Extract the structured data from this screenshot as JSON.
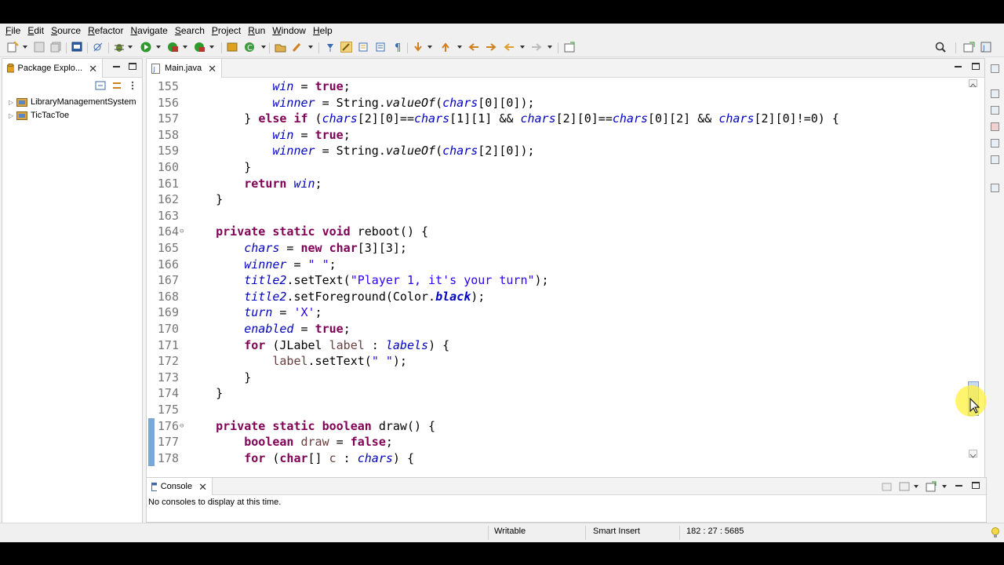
{
  "menu": [
    "File",
    "Edit",
    "Source",
    "Refactor",
    "Navigate",
    "Search",
    "Project",
    "Run",
    "Window",
    "Help"
  ],
  "left_view": {
    "tab_label": "Package Explo...",
    "projects": [
      "LibraryManagementSystem",
      "TicTacToe"
    ]
  },
  "editor": {
    "tab_label": "Main.java",
    "lines": [
      {
        "n": "155",
        "html": "            <span class=\"fld\">win</span> = <span class=\"kw\">true</span>;"
      },
      {
        "n": "156",
        "html": "            <span class=\"fld\">winner</span> = String.<span class=\"smeth\">valueOf</span>(<span class=\"fld\">chars</span>[0][0]);"
      },
      {
        "n": "157",
        "html": "        } <span class=\"kw\">else if</span> (<span class=\"fld\">chars</span>[2][0]==<span class=\"fld\">chars</span>[1][1] &amp;&amp; <span class=\"fld\">chars</span>[2][0]==<span class=\"fld\">chars</span>[0][2] &amp;&amp; <span class=\"fld\">chars</span>[2][0]!=0) {"
      },
      {
        "n": "158",
        "html": "            <span class=\"fld\">win</span> = <span class=\"kw\">true</span>;"
      },
      {
        "n": "159",
        "html": "            <span class=\"fld\">winner</span> = String.<span class=\"smeth\">valueOf</span>(<span class=\"fld\">chars</span>[2][0]);"
      },
      {
        "n": "160",
        "html": "        }"
      },
      {
        "n": "161",
        "html": "        <span class=\"kw\">return</span> <span class=\"fld\">win</span>;"
      },
      {
        "n": "162",
        "html": "    }"
      },
      {
        "n": "163",
        "html": ""
      },
      {
        "n": "164",
        "fold": true,
        "html": "    <span class=\"kw\">private static void</span> reboot() {"
      },
      {
        "n": "165",
        "html": "        <span class=\"fld\">chars</span> = <span class=\"kw\">new char</span>[3][3];"
      },
      {
        "n": "166",
        "html": "        <span class=\"fld\">winner</span> = <span class=\"str\">\" \"</span>;"
      },
      {
        "n": "167",
        "html": "        <span class=\"fld\">title2</span>.setText(<span class=\"str\">\"Player 1, it's your turn\"</span>);"
      },
      {
        "n": "168",
        "html": "        <span class=\"fld\">title2</span>.setForeground(Color.<span class=\"sfld\">black</span>);"
      },
      {
        "n": "169",
        "html": "        <span class=\"fld\">turn</span> = <span class=\"str\">'X'</span>;"
      },
      {
        "n": "170",
        "html": "        <span class=\"fld\">enabled</span> = <span class=\"kw\">true</span>;"
      },
      {
        "n": "171",
        "html": "        <span class=\"kw\">for</span> (JLabel <span class=\"loc\">label</span> : <span class=\"fld\">labels</span>) {"
      },
      {
        "n": "172",
        "html": "            <span class=\"loc\">label</span>.setText(<span class=\"str\">\" \"</span>);"
      },
      {
        "n": "173",
        "html": "        }"
      },
      {
        "n": "174",
        "html": "    }"
      },
      {
        "n": "175",
        "html": ""
      },
      {
        "n": "176",
        "fold": true,
        "html": "    <span class=\"kw\">private static boolean</span> draw() {"
      },
      {
        "n": "177",
        "html": "        <span class=\"kw\">boolean</span> <span class=\"loc\">draw</span> = <span class=\"kw\">false</span>;"
      },
      {
        "n": "178",
        "html": "        <span class=\"kw\">for</span> (<span class=\"kw\">char</span>[] <span class=\"loc\">c</span> : <span class=\"fld\">chars</span>) {"
      }
    ]
  },
  "console": {
    "tab_label": "Console",
    "message": "No consoles to display at this time."
  },
  "status": {
    "writable": "Writable",
    "insert_mode": "Smart Insert",
    "position": "182 : 27 : 5685"
  }
}
